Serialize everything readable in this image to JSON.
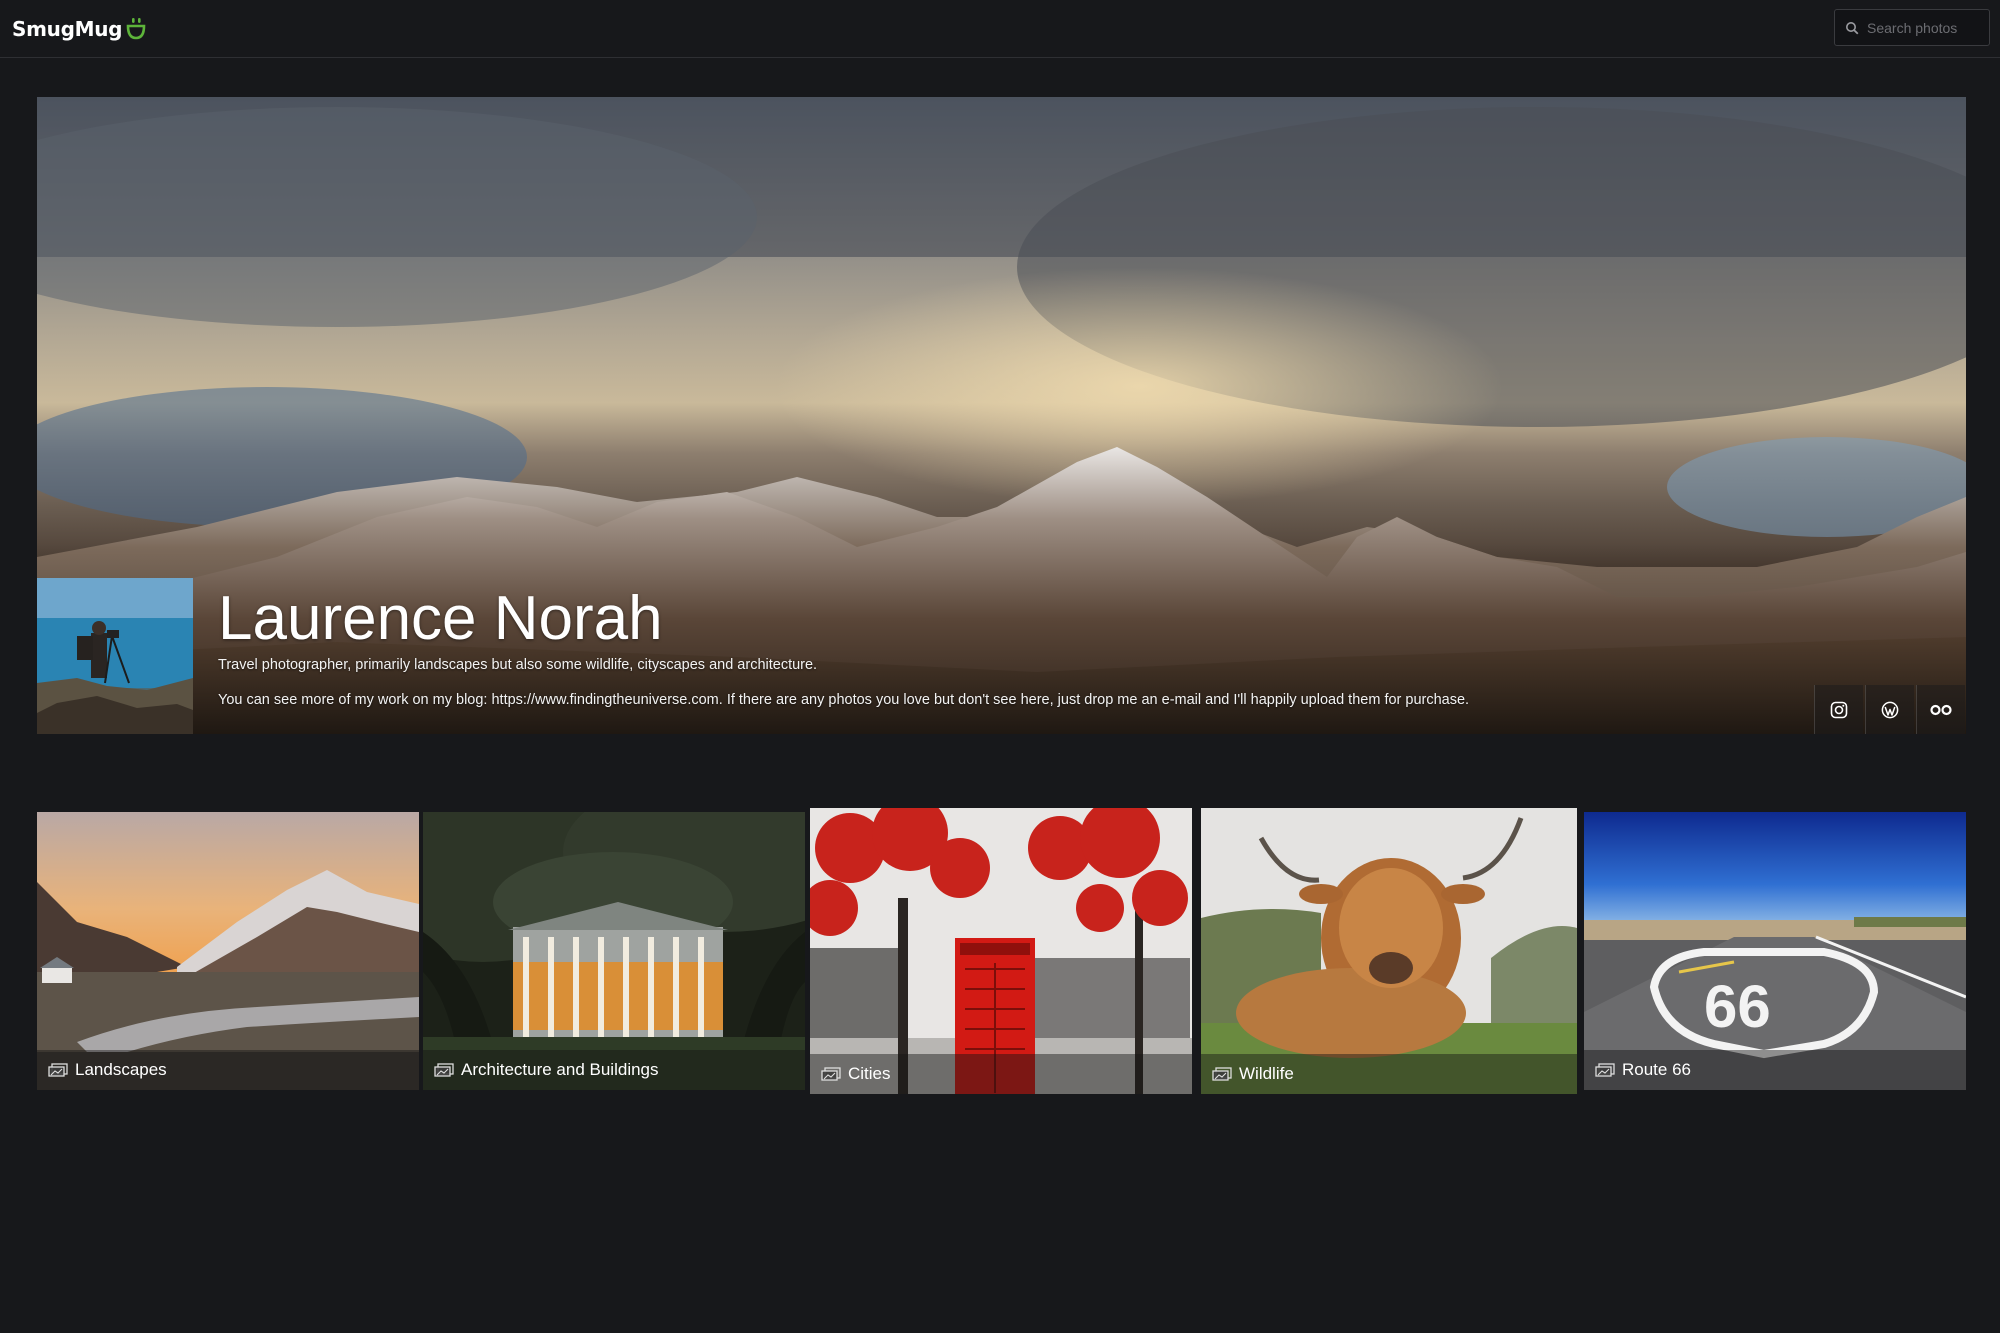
{
  "brand": {
    "name": "SmugMug",
    "accent": "#5db43a"
  },
  "search": {
    "placeholder": "Search photos",
    "icon": "search-icon"
  },
  "profile": {
    "name": "Laurence Norah",
    "bio_line1": "Travel photographer, primarily landscapes but also some wildlife, cityscapes and architecture.",
    "bio_line2": "You can see more of my work on my blog: https://www.findingtheuniverse.com. If there are any photos you love but don't see here, just drop me an e-mail and I'll happily upload them for purchase.",
    "social": [
      {
        "icon": "instagram-icon"
      },
      {
        "icon": "wordpress-icon"
      },
      {
        "icon": "flickr-icon"
      }
    ]
  },
  "galleries": [
    {
      "title": "Landscapes",
      "icon": "gallery-icon"
    },
    {
      "title": "Architecture and Buildings",
      "icon": "gallery-icon"
    },
    {
      "title": "Cities",
      "icon": "gallery-icon"
    },
    {
      "title": "Wildlife",
      "icon": "gallery-icon"
    },
    {
      "title": "Route 66",
      "icon": "gallery-icon"
    }
  ]
}
